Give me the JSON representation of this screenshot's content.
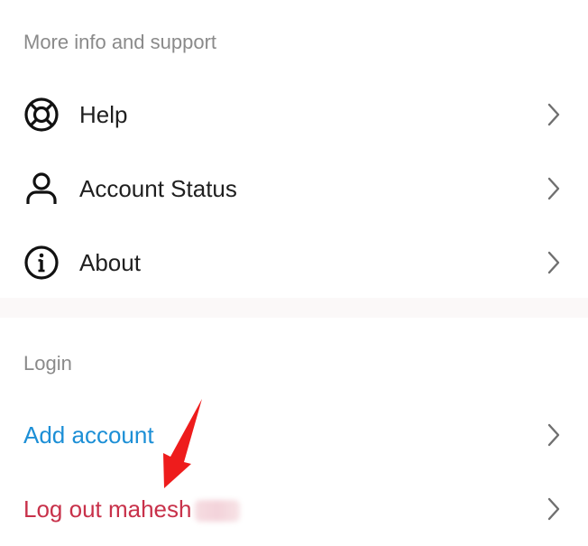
{
  "sections": {
    "support": {
      "header": "More info and support",
      "items": [
        {
          "label": "Help",
          "icon": "lifebuoy-icon"
        },
        {
          "label": "Account Status",
          "icon": "person-icon"
        },
        {
          "label": "About",
          "icon": "info-icon"
        }
      ]
    },
    "login": {
      "header": "Login",
      "add_account": "Add account",
      "logout": "Log out mahesh"
    }
  },
  "colors": {
    "link_blue": "#1c8fd6",
    "logout_red": "#c8314a",
    "annotation_arrow": "#ee1c1c"
  }
}
